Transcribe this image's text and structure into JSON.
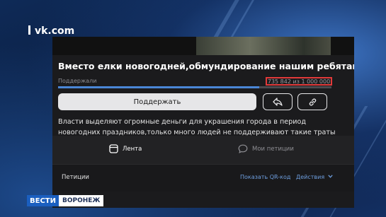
{
  "site": {
    "label": "vk.com"
  },
  "petition": {
    "title": "Вместо елки новогодней,обмундирование нашим ребятам",
    "supported_label": "Поддержали",
    "count_text": "735 842 из 1 000 000",
    "progress_fraction": 0.736,
    "support_button": "Поддержать",
    "description": "Власти выделяют огромные деньги для украшения города в период новогодних праздников,только много людей не поддерживают такие траты .Давайте"
  },
  "tabs": [
    {
      "label": "Лента",
      "icon": "feed-icon"
    },
    {
      "label": "Мои петиции",
      "icon": "chat-bubble-icon"
    }
  ],
  "bottom_bar": {
    "title": "Петиции",
    "qr_label": "Показать QR-код",
    "actions_label": "Действия"
  },
  "broadcast": {
    "channel": "ВЕСТИ",
    "city": "ВОРОНЕЖ"
  }
}
